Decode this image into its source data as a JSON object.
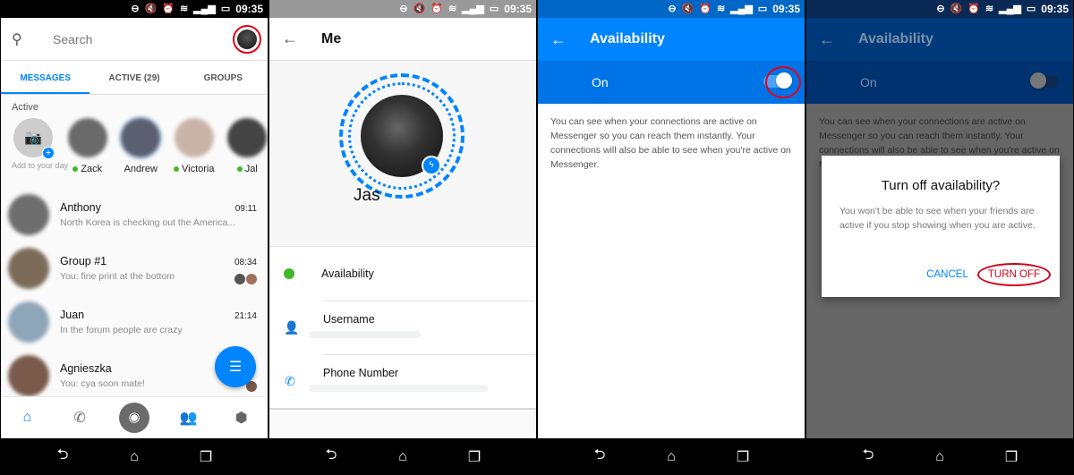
{
  "status_bar": {
    "time": "09:35",
    "icons": [
      "dnd-icon",
      "mute-icon",
      "alarm-icon",
      "wifi-icon",
      "signal-icon",
      "battery-icon"
    ]
  },
  "system_nav": {
    "back": "⮌",
    "home": "⌂",
    "recents": "❐"
  },
  "screen1": {
    "search_placeholder": "Search",
    "tabs": [
      {
        "label": "MESSAGES",
        "active": true
      },
      {
        "label": "ACTIVE (29)",
        "active": false
      },
      {
        "label": "GROUPS",
        "active": false
      }
    ],
    "active_title": "Active",
    "add_to_day": "Add to your day",
    "active_people": [
      {
        "name": "Zack",
        "online": true,
        "color": "#6a6a6a"
      },
      {
        "name": "Andrew",
        "online": false,
        "color": "#5a6070"
      },
      {
        "name": "Victoria",
        "online": true,
        "color": "#c9b5a8"
      },
      {
        "name": "Jal",
        "online": true,
        "color": "#444444"
      }
    ],
    "chats": [
      {
        "name": "Anthony",
        "time": "09:11",
        "preview": "North Korea is checking out the America...",
        "color": "#6e6e6e",
        "seen": false
      },
      {
        "name": "Group #1",
        "time": "08:34",
        "preview": "You: fine print at the bottom",
        "color": "#7d6b5a",
        "seen": true
      },
      {
        "name": "Juan",
        "time": "21:14",
        "preview": "In the forum people are crazy",
        "color": "#8fa6b8",
        "seen": false
      },
      {
        "name": "Agnieszka",
        "time": "",
        "preview": "You: cya soon mate!",
        "color": "#7a5a4a",
        "seen": true
      }
    ],
    "bottom_tabs": [
      "home-icon",
      "phone-icon",
      "camera-icon",
      "people-icon",
      "discover-icon"
    ]
  },
  "screen2": {
    "title": "Me",
    "name": "Jas",
    "items": [
      {
        "label": "Availability",
        "icon": "status-dot-icon"
      },
      {
        "label": "Username",
        "icon": "person-icon"
      },
      {
        "label": "Phone Number",
        "icon": "phone-icon"
      }
    ]
  },
  "screen3": {
    "title": "Availability",
    "toggle_label": "On",
    "toggle_on": true,
    "description": "You can see when your connections are active on Messenger so you can reach them instantly. Your connections will also be able to see when you're active on Messenger."
  },
  "screen4": {
    "title": "Availability",
    "toggle_label": "On",
    "toggle_on": false,
    "description": "You can see when your connections are active on Messenger so you can reach them instantly. Your connections will also be able to see when you're active on Messenger.",
    "dialog": {
      "title": "Turn off availability?",
      "body": "You won't be able to see when your friends are active if you stop showing when you are active.",
      "cancel": "CANCEL",
      "confirm": "TURN OFF"
    }
  }
}
